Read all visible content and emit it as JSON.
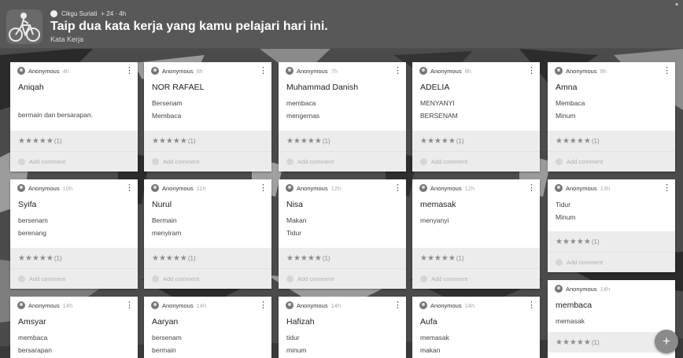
{
  "header": {
    "author": "Cikgu Suriati",
    "meta": "+ 24 · 4h",
    "title": "Taip dua kata kerja yang kamu pelajari hari ini.",
    "subtitle": "Kata Kerja"
  },
  "rating_text": {
    "stars": "★★★★★",
    "count": "(1)"
  },
  "comment_placeholder": "Add comment",
  "cards": [
    {
      "author": "Anonymous",
      "time": "4h",
      "title": "Aniqah",
      "lines": [
        "",
        "bermain dan bersarapan."
      ]
    },
    {
      "author": "Anonymous",
      "time": "8h",
      "title": "NOR RAFAEL",
      "lines": [
        "Bersenam",
        "Membaca"
      ]
    },
    {
      "author": "Anonymous",
      "time": "7h",
      "title": "Muhammad Danish",
      "lines": [
        "membaca",
        "mengemas"
      ]
    },
    {
      "author": "Anonymous",
      "time": "8h",
      "title": "ADELIA",
      "lines": [
        "MENYANYI",
        "BERSENAM"
      ]
    },
    {
      "author": "Anonymous",
      "time": "8h",
      "title": "Amna",
      "lines": [
        "Membaca",
        "Minum"
      ]
    },
    {
      "author": "Anonymous",
      "time": "10h",
      "title": "Syifa",
      "lines": [
        "bersenam",
        "berenang"
      ]
    },
    {
      "author": "Anonymous",
      "time": "11h",
      "title": "Nurul",
      "lines": [
        "Bermain",
        "menyiram"
      ]
    },
    {
      "author": "Anonymous",
      "time": "12h",
      "title": "Nisa",
      "lines": [
        "Makan",
        "Tidur"
      ]
    },
    {
      "author": "Anonymous",
      "time": "12h",
      "title": "memasak",
      "lines": [
        "menyanyi",
        ""
      ]
    },
    {
      "author": "Anonymous",
      "time": "13h",
      "title": "",
      "lines": [
        "Tidur",
        "Minum"
      ]
    },
    {
      "author": "Anonymous",
      "time": "14h",
      "title": "membaca",
      "lines": [
        "memasak"
      ]
    },
    {
      "author": "Anonymous",
      "time": "14h",
      "title": "Amsyar",
      "lines": [
        "membaca",
        "bersarapan"
      ]
    },
    {
      "author": "Anonymous",
      "time": "14h",
      "title": "Aaryan",
      "lines": [
        "bersenam",
        "bermain"
      ]
    },
    {
      "author": "Anonymous",
      "time": "14h",
      "title": "Hafizah",
      "lines": [
        "tidur",
        "minum"
      ]
    },
    {
      "author": "Anonymous",
      "time": "14h",
      "title": "Aufa",
      "lines": [
        "memasak",
        "makan"
      ]
    }
  ],
  "fab": {
    "label": "+"
  }
}
